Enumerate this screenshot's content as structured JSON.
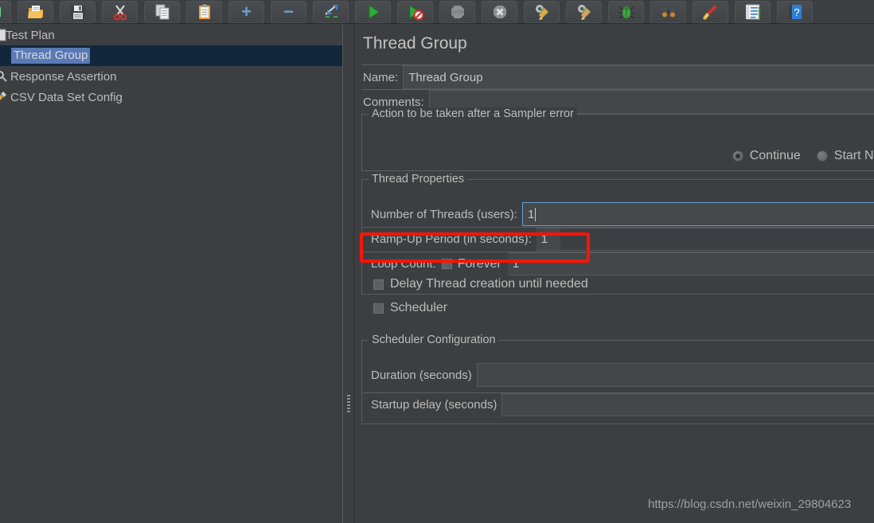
{
  "toolbar": {
    "buttons": [
      {
        "name": "new-test-plan-button",
        "icon": "new-document-icon",
        "label": "New"
      },
      {
        "name": "open-button",
        "icon": "open-folder-icon",
        "label": "Open"
      },
      {
        "name": "save-button",
        "icon": "save-floppy-icon",
        "label": "Save"
      },
      {
        "name": "cut-button",
        "icon": "scissors-icon",
        "label": "Cut"
      },
      {
        "name": "copy-button",
        "icon": "copy-pages-icon",
        "label": "Copy"
      },
      {
        "name": "paste-button",
        "icon": "clipboard-icon",
        "label": "Paste"
      },
      {
        "name": "expand-all-button",
        "icon": "plus-icon",
        "label": "+"
      },
      {
        "name": "collapse-all-button",
        "icon": "minus-icon",
        "label": "−"
      },
      {
        "name": "toggle-button",
        "icon": "toggle-arrows-icon",
        "label": "Toggle"
      },
      {
        "name": "start-button",
        "icon": "green-play-icon",
        "label": "Start"
      },
      {
        "name": "start-no-timers-button",
        "icon": "play-no-timers-icon",
        "label": "Start no pauses"
      },
      {
        "name": "stop-button",
        "icon": "stop-sign-icon",
        "label": "Stop"
      },
      {
        "name": "shutdown-button",
        "icon": "shutdown-octagon-icon",
        "label": "Shutdown"
      },
      {
        "name": "clear-button",
        "icon": "gear-broom-icon",
        "label": "Clear"
      },
      {
        "name": "clear-all-button",
        "icon": "gear-broom-all-icon",
        "label": "Clear All"
      },
      {
        "name": "function-helper-button",
        "icon": "green-bug-icon",
        "label": "Function Helper"
      },
      {
        "name": "search-button",
        "icon": "binoculars-icon",
        "label": "Search"
      },
      {
        "name": "reset-search-button",
        "icon": "broom-icon",
        "label": "Reset Search"
      },
      {
        "name": "templates-button",
        "icon": "notebook-icon",
        "label": "Templates"
      },
      {
        "name": "help-button",
        "icon": "help-book-icon",
        "label": "Help"
      }
    ]
  },
  "tree": {
    "items": [
      {
        "label": "Test Plan",
        "icon": "test-plan-icon",
        "selected": false,
        "indent": 0
      },
      {
        "label": "Thread Group",
        "icon": "thread-group-icon",
        "selected": true,
        "indent": 1
      },
      {
        "label": "Response Assertion",
        "icon": "assertion-icon",
        "selected": false,
        "indent": 1
      },
      {
        "label": "CSV Data Set Config",
        "icon": "config-wrench-icon",
        "selected": false,
        "indent": 1
      }
    ]
  },
  "panel": {
    "title": "Thread Group",
    "name_label": "Name:",
    "name_value": "Thread Group",
    "comments_label": "Comments:",
    "comments_value": "",
    "sampler_error": {
      "legend": "Action to be taken after a Sampler error",
      "options": [
        {
          "label": "Continue",
          "selected": true
        },
        {
          "label": "Start Next Thread Lo",
          "selected": false
        }
      ]
    },
    "thread_properties": {
      "legend": "Thread Properties",
      "num_threads_label": "Number of Threads (users):",
      "num_threads_value": "1",
      "ramp_up_label": "Ramp-Up Period (in seconds):",
      "ramp_up_value": "1",
      "loop_count_label": "Loop Count:",
      "forever_label": "Forever",
      "forever_checked": false,
      "loop_count_value": "1",
      "delay_thread_label": "Delay Thread creation until needed",
      "delay_thread_checked": false,
      "scheduler_label": "Scheduler",
      "scheduler_checked": false
    },
    "scheduler_configuration": {
      "legend": "Scheduler Configuration",
      "duration_label": "Duration (seconds)",
      "duration_value": "",
      "startup_delay_label": "Startup delay (seconds)",
      "startup_delay_value": ""
    }
  },
  "annotation": {
    "highlight_color": "#fc1408",
    "highlights": "Ramp-Up Period (in seconds)"
  },
  "watermark": {
    "text": "https://blog.csdn.net/weixin_29804623"
  },
  "colors": {
    "background": "#3c3f41",
    "selection": "#5a7ab5",
    "selected_row": "#12273c",
    "focus_border": "#6a9fd4",
    "text": "#bcbcbc"
  }
}
